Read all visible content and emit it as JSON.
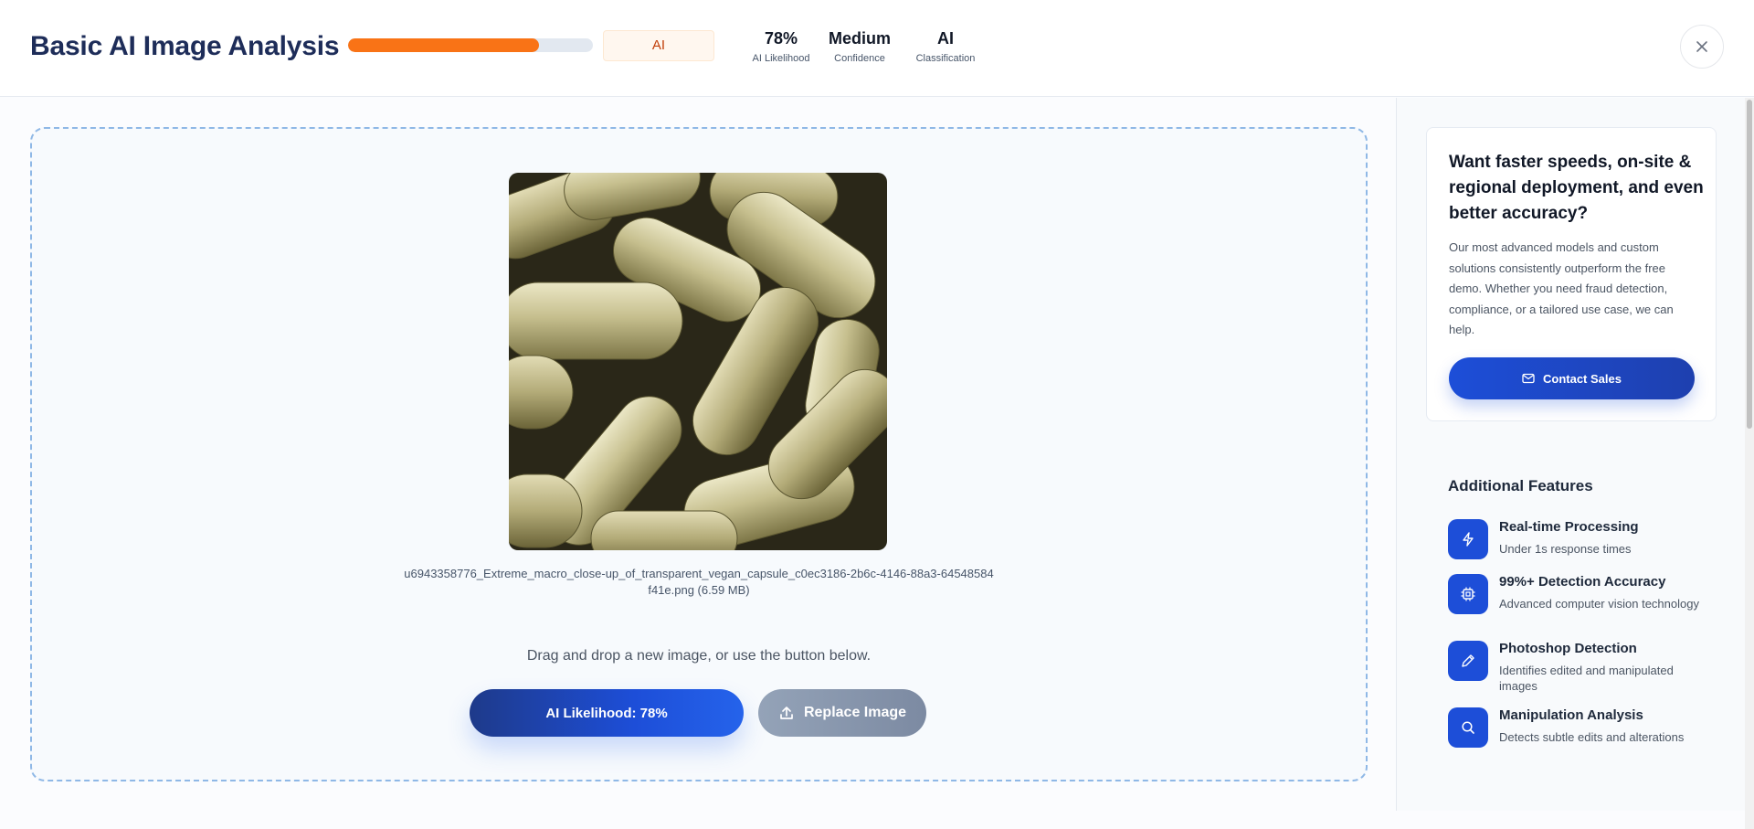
{
  "header": {
    "title": "Basic AI Image Analysis",
    "progress_percent": 78,
    "progress_color": "#f97316",
    "classification_pill": "AI",
    "stats": [
      {
        "value": "78%",
        "label": "AI Likelihood"
      },
      {
        "value": "Medium",
        "label": "Confidence"
      },
      {
        "value": "AI",
        "label": "Classification"
      }
    ],
    "close_icon": "close-icon"
  },
  "main": {
    "filename_line1": "u6943358776_Extreme_macro_close-up_of_transparent_vegan_capsule_c0ec3186-2b6c-4146-88a3-64548584",
    "filename_line2": "f41e.png (6.59 MB)",
    "hint": "Drag and drop a new image, or use the button below.",
    "likelihood_button": "AI Likelihood: 78%",
    "replace_button": "Replace Image",
    "replace_icon": "upload-icon"
  },
  "sidebar": {
    "promo_title": "Want faster speeds, on-site & regional deployment, and even better accuracy?",
    "promo_body": "Our most advanced models and custom solutions consistently outperform the free demo. Whether you need fraud detection, compliance, or a tailored use case, we can help.",
    "contact_button": "Contact Sales",
    "contact_icon": "mail-icon",
    "features_title": "Additional Features",
    "features": [
      {
        "icon": "bolt-icon",
        "name": "Real-time Processing",
        "desc": "Under 1s response times"
      },
      {
        "icon": "chip-icon",
        "name": "99%+ Detection Accuracy",
        "desc": "Advanced computer vision technology"
      },
      {
        "icon": "pencil-icon",
        "name": "Photoshop Detection",
        "desc": "Identifies edited and manipulated images"
      },
      {
        "icon": "search-icon",
        "name": "Manipulation Analysis",
        "desc": "Detects subtle edits and alterations"
      }
    ]
  },
  "colors": {
    "accent_blue": "#1d4ed8",
    "title_navy": "#1e2d59",
    "ai_orange": "#f97316"
  }
}
